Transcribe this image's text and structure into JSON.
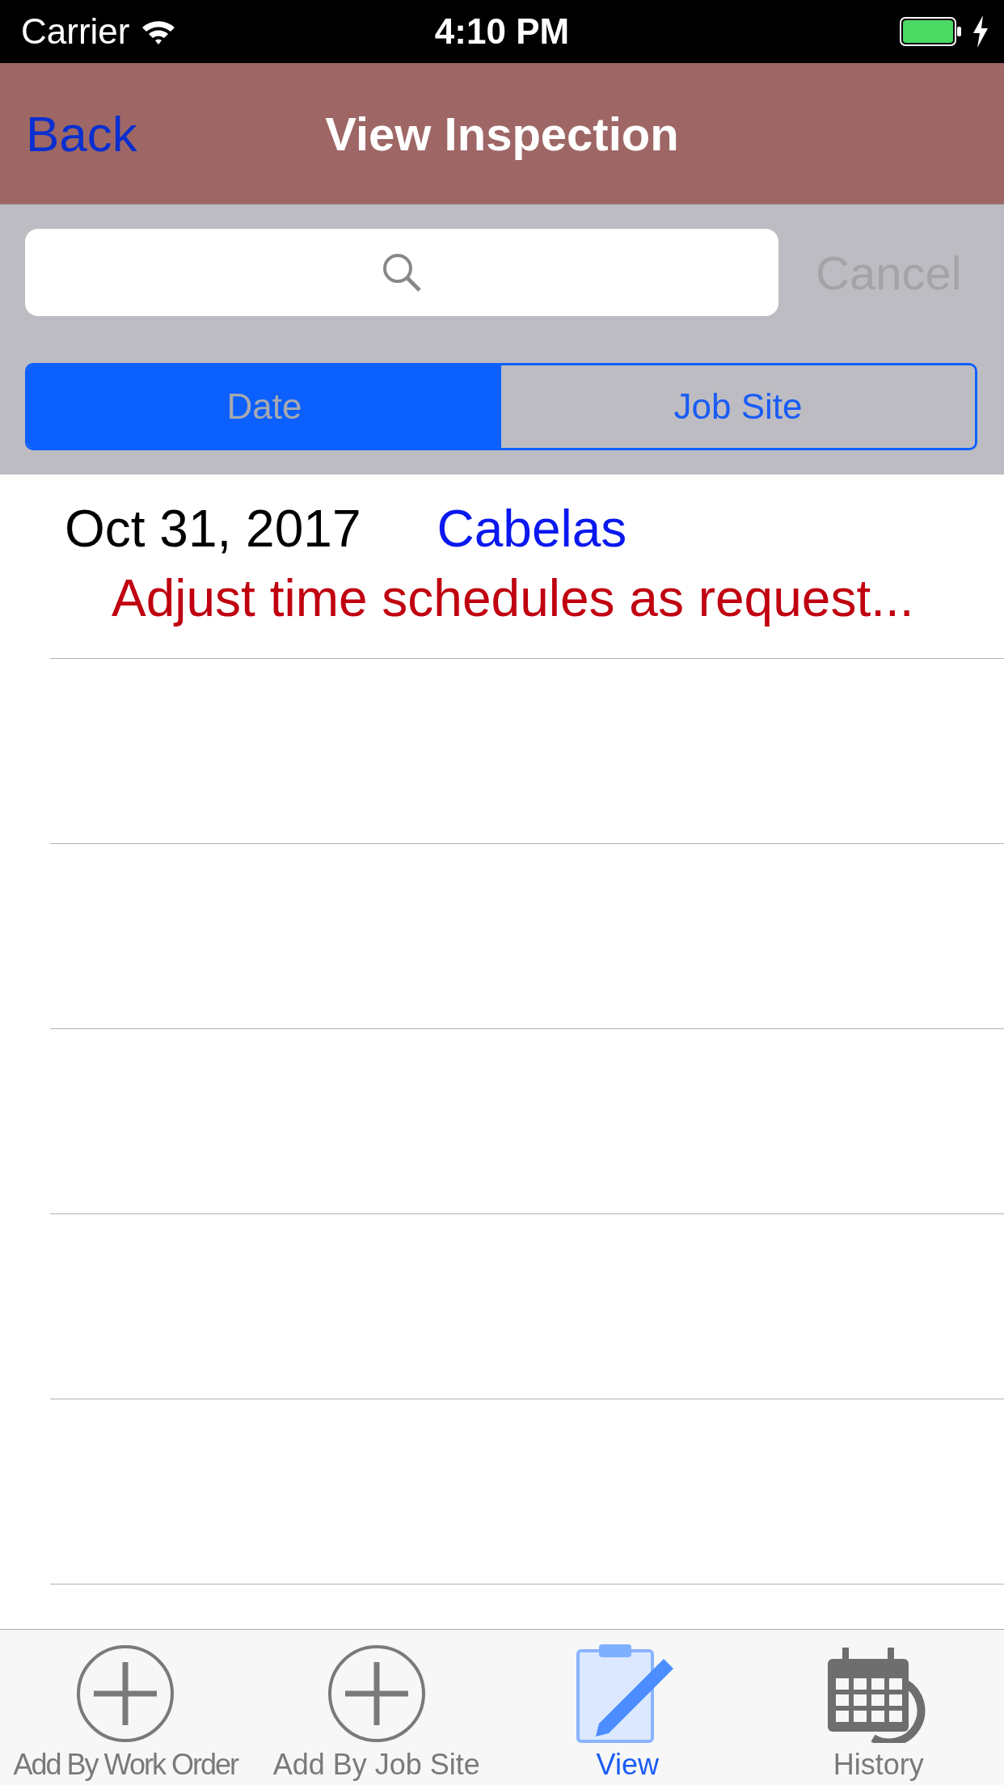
{
  "status_bar": {
    "carrier": "Carrier",
    "time": "4:10 PM"
  },
  "nav": {
    "back": "Back",
    "title": "View Inspection"
  },
  "search": {
    "cancel": "Cancel"
  },
  "segments": [
    {
      "label": "Date",
      "selected": true
    },
    {
      "label": "Job Site",
      "selected": false
    }
  ],
  "rows": [
    {
      "date": "Oct 31, 2017",
      "site": "Cabelas",
      "description": "Adjust time schedules as request..."
    }
  ],
  "tabs": [
    {
      "label": "Add By Work Order",
      "kind": "plus",
      "selected": false
    },
    {
      "label": "Add By Job Site",
      "kind": "plus",
      "selected": false
    },
    {
      "label": "View",
      "kind": "clipboard",
      "selected": true
    },
    {
      "label": "History",
      "kind": "calendar",
      "selected": false
    }
  ]
}
